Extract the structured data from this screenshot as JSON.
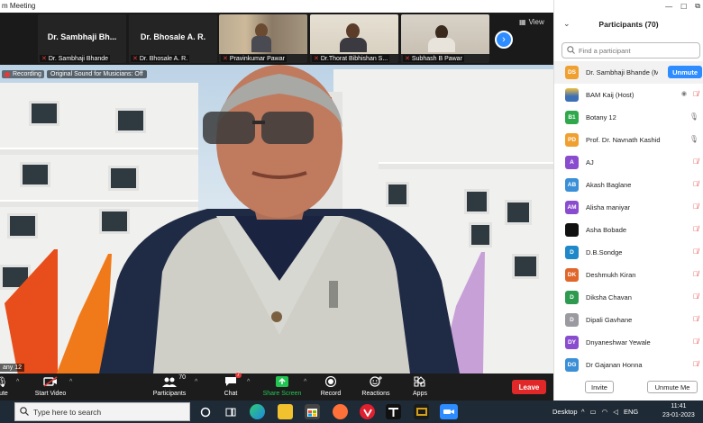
{
  "window": {
    "title": "m Meeting"
  },
  "strip": {
    "tiles": [
      {
        "name": "Dr. Sambhaji Bh...",
        "label": "Dr. Sambhaji Bhande",
        "video": false
      },
      {
        "name": "Dr. Bhosale A. R.",
        "label": "Dr. Bhosale A. R.",
        "video": false
      },
      {
        "name": "",
        "label": "Pravinkumar Pawar",
        "video": true
      },
      {
        "name": "",
        "label": "Dr.Thorat Bibhishan S...",
        "video": true
      },
      {
        "name": "",
        "label": "Subhash B Pawar",
        "video": true
      }
    ],
    "view_label": "View",
    "next_icon": "chevron-right-icon"
  },
  "main": {
    "recording_label": "Recording",
    "original_sound": "Original Sound for Musicians: Off",
    "speaker_label": "any 12"
  },
  "toolbar": {
    "mute_label": "nute",
    "start_video_label": "Start Video",
    "participants_label": "Participants",
    "participants_count": "70",
    "chat_label": "Chat",
    "chat_badge": "7",
    "share_label": "Share Screen",
    "record_label": "Record",
    "reactions_label": "Reactions",
    "apps_label": "Apps",
    "leave_label": "Leave"
  },
  "panel": {
    "title": "Participants (70)",
    "search_placeholder": "Find a participant",
    "unmute_label": "Unmute",
    "invite_label": "Invite",
    "unmute_me_label": "Unmute Me",
    "participants": [
      {
        "initials": "DS",
        "name": "Dr. Sambhaji Bhande (Me)",
        "color": "#f0a030",
        "mic": "muted"
      },
      {
        "initials": "",
        "name": "BAM Kaij (Host)",
        "color": "#3c6fb4",
        "mic": "muted"
      },
      {
        "initials": "B1",
        "name": "Botany 12",
        "color": "#2ea84a",
        "mic": "on"
      },
      {
        "initials": "PD",
        "name": "Prof. Dr. Navnath Kashid",
        "color": "#f0a030",
        "mic": "on"
      },
      {
        "initials": "A",
        "name": "AJ",
        "color": "#8a4ccf",
        "mic": "muted"
      },
      {
        "initials": "AB",
        "name": "Akash Baglane",
        "color": "#3a8fd6",
        "mic": "muted"
      },
      {
        "initials": "AM",
        "name": "Alisha maniyar",
        "color": "#8a4ccf",
        "mic": "muted"
      },
      {
        "initials": "",
        "name": "Asha Bobade",
        "color": "#111111",
        "mic": "muted"
      },
      {
        "initials": "D",
        "name": "D.B.Sondge",
        "color": "#1e88c8",
        "mic": "muted"
      },
      {
        "initials": "DK",
        "name": "Deshmukh Kiran",
        "color": "#e0662a",
        "mic": "muted"
      },
      {
        "initials": "D",
        "name": "Diksha Chavan",
        "color": "#2e9a4f",
        "mic": "muted"
      },
      {
        "initials": "D",
        "name": "Dipali Gavhane",
        "color": "#9a9aa0",
        "mic": "muted"
      },
      {
        "initials": "DY",
        "name": "Dnyaneshwar Yewale",
        "color": "#8a4ccf",
        "mic": "muted"
      },
      {
        "initials": "DG",
        "name": "Dr Gajanan Honna",
        "color": "#3a8fd6",
        "mic": "muted"
      }
    ]
  },
  "taskbar": {
    "search_placeholder": "Type here to search",
    "desktop_label": "Desktop",
    "lang": "ENG",
    "time": "11:41",
    "date": "23-01-2023"
  }
}
